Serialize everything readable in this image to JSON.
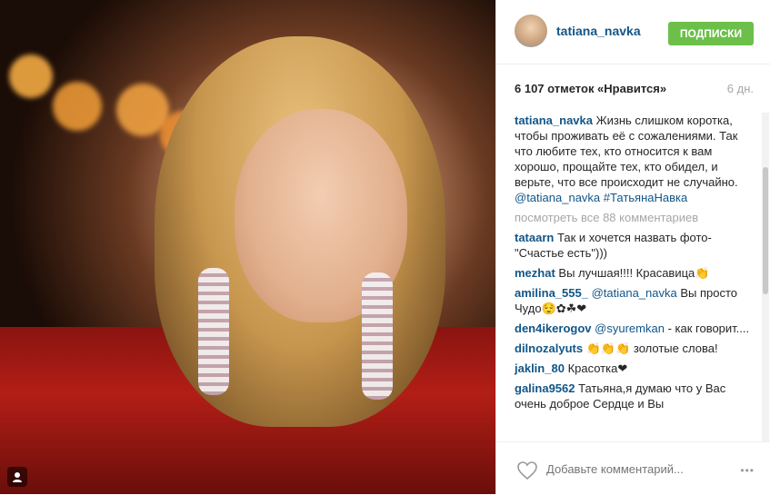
{
  "post": {
    "username": "tatiana_navka",
    "follow_label": "ПОДПИСКИ",
    "likes": "6 107 отметок «Нравится»",
    "age": "6 дн.",
    "caption": {
      "user": "tatiana_navka",
      "text": "Жизнь слишком коротка, чтобы проживать её с сожалениями. Так что любите тех, кто относится к вам хорошо, прощайте тех, кто обидел, и верьте, что все происходит не случайно.",
      "mention": "@tatiana_navka",
      "hashtag": "#ТатьянаНавка"
    },
    "view_all": "посмотреть все 88 комментариев",
    "comments": [
      {
        "user": "tataarn",
        "text": "Так и хочется назвать фото-\"Счастье есть\")))"
      },
      {
        "user": "mezhat",
        "text": "Вы лучшая!!!! Красавица👏"
      },
      {
        "user": "amilina_555_",
        "mention": "@tatiana_navka",
        "text": "Вы просто Чудо😌✿☘❤"
      },
      {
        "user": "den4ikerogov",
        "mention": "@syuremkan",
        "text": "- как говорит...."
      },
      {
        "user": "dilnozalyuts",
        "text": "👏👏👏 золотые слова!"
      },
      {
        "user": "jaklin_80",
        "text": "Красотка❤"
      },
      {
        "user": "galina9562",
        "text": "Татьяна,я думаю что у Вас очень доброе Сердце и Вы"
      }
    ],
    "add_comment_placeholder": "Добавьте комментарий...",
    "more_label": "•••"
  },
  "icons": [
    "camera-icon",
    "heart-icon",
    "more-icon"
  ],
  "colors": {
    "link": "#125688",
    "follow_button": "#6cc04a",
    "muted": "#a5a7aa"
  }
}
